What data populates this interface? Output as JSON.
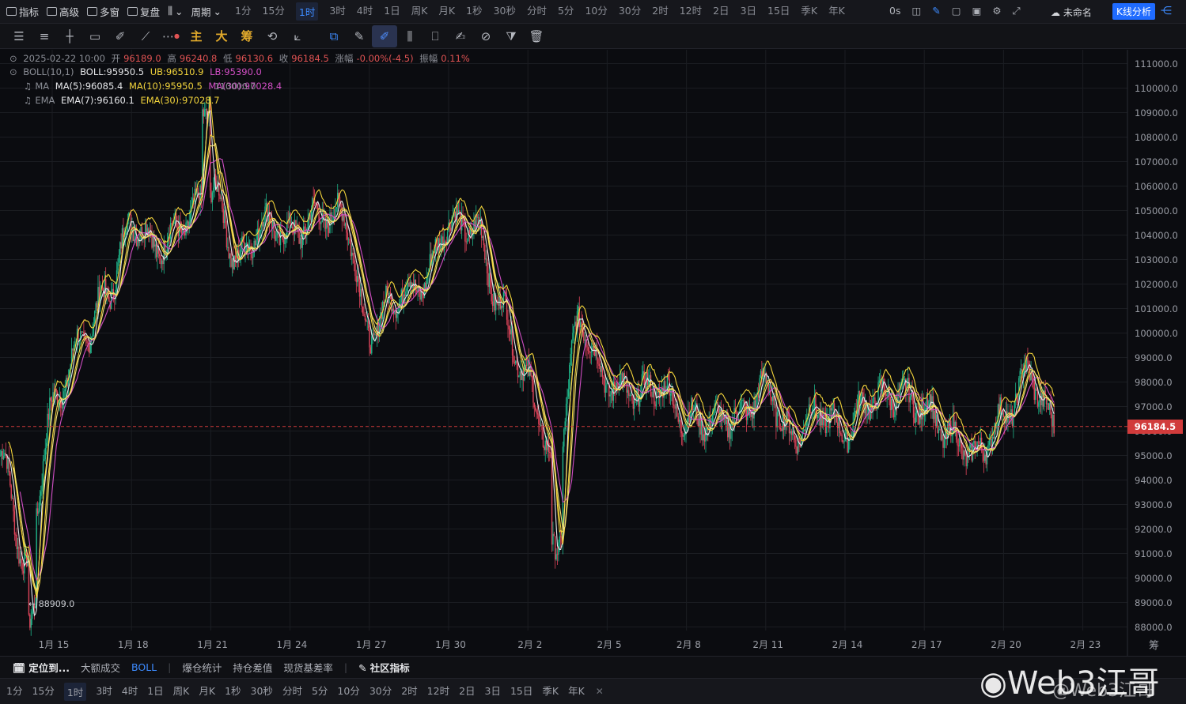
{
  "top": {
    "menu": [
      {
        "label": "指标",
        "icon": "indicator-icon"
      },
      {
        "label": "高级",
        "icon": "advanced-icon"
      },
      {
        "label": "多窗",
        "icon": "multi-window-icon"
      },
      {
        "label": "复盘",
        "icon": "replay-icon"
      }
    ],
    "chart_style_icon": "candlestick-style-icon",
    "period_label": "周期",
    "timeframes": [
      "1分",
      "15分",
      "1时",
      "3时",
      "4时",
      "1日",
      "周K",
      "月K",
      "1秒",
      "30秒",
      "分时",
      "5分",
      "10分",
      "30分",
      "2时",
      "12时",
      "2日",
      "3日",
      "15日",
      "季K",
      "年K"
    ],
    "active_timeframe": "1时",
    "latency": "0s",
    "unnamed_label": "未命名",
    "analysis_button": "K线分析"
  },
  "toolbar": {
    "gold_tools": [
      "主",
      "大",
      "筹"
    ]
  },
  "legend": {
    "ohlc": {
      "time": "2025-02-22 10:00",
      "open_label": "开",
      "open": "96189.0",
      "high_label": "高",
      "high": "96240.8",
      "low_label": "低",
      "low": "96130.6",
      "close_label": "收",
      "close": "96184.5",
      "change_label": "涨幅",
      "change": "-0.00%(-4.5)",
      "amp_label": "振幅",
      "amp": "0.11%"
    },
    "boll": {
      "name": "BOLL(10,1)",
      "mid": "BOLL:95950.5",
      "ub": "UB:96510.9",
      "lb": "LB:95390.0"
    },
    "ma": {
      "name": "MA",
      "ma5": "MA(5):96085.4",
      "ma10": "MA(10):95950.5",
      "ma30": "MA(30):97028.4"
    },
    "ema": {
      "name": "EMA",
      "ema7": "EMA(7):96160.1",
      "ema30": "EMA(30):97028.7"
    },
    "cursor_value": "110000.0"
  },
  "price_axis": [
    "111000.0",
    "110000.0",
    "109000.0",
    "108000.0",
    "107000.0",
    "106000.0",
    "105000.0",
    "104000.0",
    "103000.0",
    "102000.0",
    "101000.0",
    "100000.0",
    "99000.0",
    "98000.0",
    "97000.0",
    "96000.0",
    "95000.0",
    "94000.0",
    "93000.0",
    "92000.0",
    "91000.0",
    "90000.0",
    "89000.0",
    "88000.0"
  ],
  "current_price": "96184.5",
  "min_label": "← 88909.0",
  "corner_label": "筹",
  "time_axis": [
    "1月 15",
    "1月 18",
    "1月 21",
    "1月 24",
    "1月 27",
    "1月 30",
    "2月 2",
    "2月 5",
    "2月 8",
    "2月 11",
    "2月 14",
    "2月 17",
    "2月 20",
    "2月 23"
  ],
  "indicator_bar": {
    "locate": "定位到...",
    "items": [
      "大额成交",
      "BOLL",
      "爆仓统计",
      "持仓差值",
      "现货基差率"
    ],
    "community": "社区指标"
  },
  "bottom_timeframes": [
    "1分",
    "15分",
    "1时",
    "3时",
    "4时",
    "1日",
    "周K",
    "月K",
    "1秒",
    "30秒",
    "分时",
    "5分",
    "10分",
    "30分",
    "2时",
    "12时",
    "2日",
    "3日",
    "15日",
    "季K",
    "年K"
  ],
  "bottom_active": "1时",
  "watermark": "Web3江哥",
  "watermark_handle": "@Web3江哥",
  "colors": {
    "up": "#1fb58a",
    "down": "#e0455b",
    "ma_yellow": "#f1d33b",
    "ma_pink": "#d14ec4",
    "boll_white": "#e6e7ea",
    "accent": "#3d8bff"
  },
  "chart_data": {
    "type": "candlestick",
    "x_range": [
      "2025-01-13",
      "2025-02-23"
    ],
    "y_range": [
      88000,
      111500
    ],
    "overlays": [
      "BOLL(10,1)",
      "MA(5)",
      "MA(10)",
      "MA(30)",
      "EMA(7)",
      "EMA(30)"
    ],
    "approx_close_series": [
      {
        "date": "2025-01-13",
        "value": 95000
      },
      {
        "date": "2025-01-14",
        "value": 90500
      },
      {
        "date": "2025-01-15",
        "value": 97000
      },
      {
        "date": "2025-01-16",
        "value": 99500
      },
      {
        "date": "2025-01-17",
        "value": 101500
      },
      {
        "date": "2025-01-18",
        "value": 104500
      },
      {
        "date": "2025-01-19",
        "value": 103500
      },
      {
        "date": "2025-01-20",
        "value": 104500
      },
      {
        "date": "2025-01-21",
        "value": 106000
      },
      {
        "date": "2025-01-22",
        "value": 103000
      },
      {
        "date": "2025-01-23",
        "value": 104500
      },
      {
        "date": "2025-01-24",
        "value": 104000
      },
      {
        "date": "2025-01-25",
        "value": 104800
      },
      {
        "date": "2025-01-26",
        "value": 104800
      },
      {
        "date": "2025-01-27",
        "value": 100000
      },
      {
        "date": "2025-01-28",
        "value": 101500
      },
      {
        "date": "2025-01-29",
        "value": 102000
      },
      {
        "date": "2025-01-30",
        "value": 104500
      },
      {
        "date": "2025-01-31",
        "value": 104300
      },
      {
        "date": "2025-02-01",
        "value": 101000
      },
      {
        "date": "2025-02-02",
        "value": 98000
      },
      {
        "date": "2025-02-03",
        "value": 94500
      },
      {
        "date": "2025-02-04",
        "value": 100500
      },
      {
        "date": "2025-02-05",
        "value": 98000
      },
      {
        "date": "2025-02-06",
        "value": 97500
      },
      {
        "date": "2025-02-07",
        "value": 97800
      },
      {
        "date": "2025-02-08",
        "value": 96500
      },
      {
        "date": "2025-02-09",
        "value": 96400
      },
      {
        "date": "2025-02-10",
        "value": 96600
      },
      {
        "date": "2025-02-11",
        "value": 97800
      },
      {
        "date": "2025-02-12",
        "value": 95800
      },
      {
        "date": "2025-02-13",
        "value": 96800
      },
      {
        "date": "2025-02-14",
        "value": 96000
      },
      {
        "date": "2025-02-15",
        "value": 97300
      },
      {
        "date": "2025-02-16",
        "value": 97500
      },
      {
        "date": "2025-02-17",
        "value": 97000
      },
      {
        "date": "2025-02-18",
        "value": 95800
      },
      {
        "date": "2025-02-19",
        "value": 95000
      },
      {
        "date": "2025-02-20",
        "value": 96500
      },
      {
        "date": "2025-02-21",
        "value": 98300
      },
      {
        "date": "2025-02-22",
        "value": 96184.5
      }
    ],
    "min_marker": 88909.0,
    "current_price": 96184.5
  }
}
